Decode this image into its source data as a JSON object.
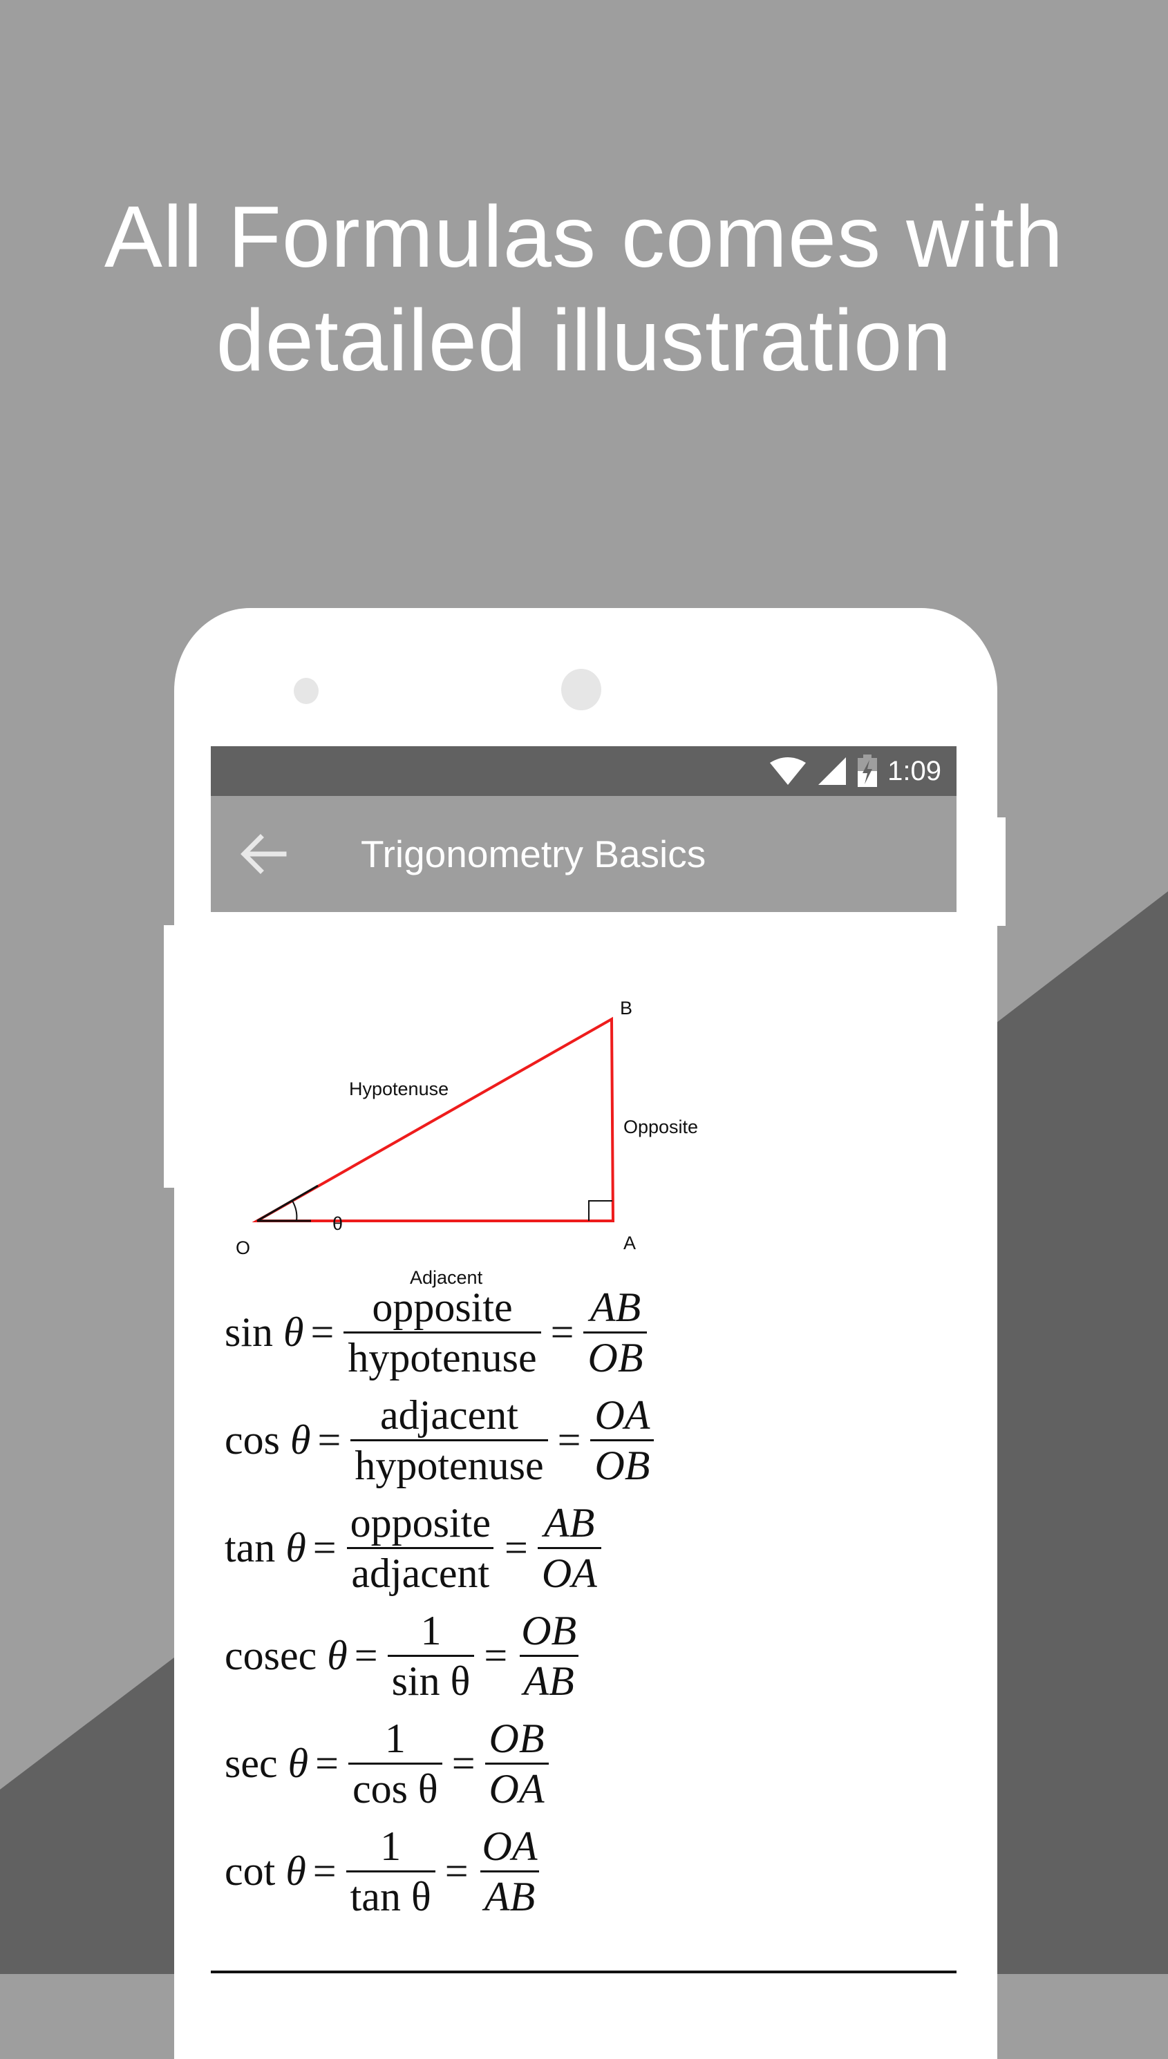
{
  "promo": {
    "headline_line1": "All Formulas comes with",
    "headline_line2": "detailed illustration"
  },
  "colors": {
    "background_light": "#9e9e9e",
    "background_dark": "#616161",
    "status_bar": "#616161",
    "app_bar": "#9e9e9e",
    "triangle_stroke": "#ee1c1c"
  },
  "status_bar": {
    "icons": [
      "wifi-icon",
      "cell-signal-icon",
      "battery-charging-icon"
    ],
    "time": "1:09"
  },
  "app_bar": {
    "back_icon": "arrow-back-icon",
    "title": "Trigonometry Basics"
  },
  "diagram": {
    "vertices": {
      "O": "O",
      "A": "A",
      "B": "B"
    },
    "labels": {
      "hypotenuse": "Hypotenuse",
      "opposite": "Opposite",
      "adjacent": "Adjacent",
      "angle": "θ"
    }
  },
  "formulas": [
    {
      "fn": "sin",
      "theta": "θ",
      "eq": "=",
      "num1": "opposite",
      "den1": "hypotenuse",
      "num2": "AB",
      "den2": "OB"
    },
    {
      "fn": "cos",
      "theta": "θ",
      "eq": "=",
      "num1": "adjacent",
      "den1": "hypotenuse",
      "num2": "OA",
      "den2": "OB"
    },
    {
      "fn": "tan",
      "theta": "θ",
      "eq": "=",
      "num1": "opposite",
      "den1": "adjacent",
      "num2": "AB",
      "den2": "OA"
    },
    {
      "fn": "cosec",
      "theta": "θ",
      "eq": "=",
      "num1": "1",
      "den1": "sin θ",
      "num2": "OB",
      "den2": "AB"
    },
    {
      "fn": "sec",
      "theta": "θ",
      "eq": "=",
      "num1": "1",
      "den1": "cos θ",
      "num2": "OB",
      "den2": "OA"
    },
    {
      "fn": "cot",
      "theta": "θ",
      "eq": "=",
      "num1": "1",
      "den1": "tan θ",
      "num2": "OA",
      "den2": "AB"
    }
  ]
}
